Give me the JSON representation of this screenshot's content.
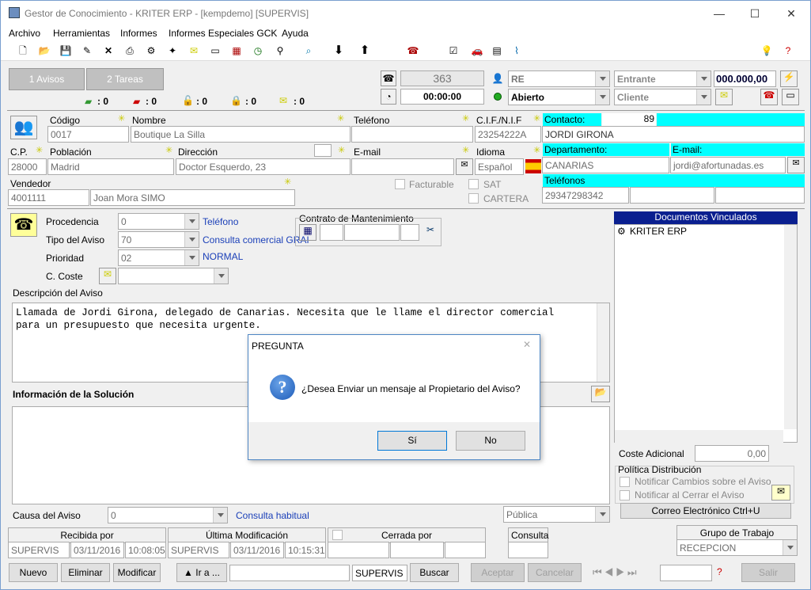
{
  "window": {
    "title": "Gestor de Conocimiento - KRITER ERP - [kempdemo] [SUPERVIS]",
    "minimize": "—",
    "maximize": "☐",
    "close": "✕"
  },
  "menu": [
    "Archivo",
    "Herramientas",
    "Informes",
    "Informes Especiales GCK",
    "Ayuda"
  ],
  "tabs": {
    "avisos": "1 Avisos",
    "tareas": "2 Tareas"
  },
  "counters": [
    ": 0",
    ": 0",
    ": 0",
    ": 0",
    ": 0"
  ],
  "call": {
    "number": "363",
    "timer": "00:00:00",
    "re": "RE",
    "state": "Abierto",
    "direction": "Entrante",
    "type": "Cliente",
    "amount": "000.000,00"
  },
  "customer": {
    "codigo_label": "Código",
    "codigo": "0017",
    "nombre_label": "Nombre",
    "nombre": "Boutique La Silla",
    "telefono_label": "Teléfono",
    "telefono": "",
    "cif_label": "C.I.F./N.I.F",
    "cif": "23254222A",
    "cp_label": "C.P.",
    "cp": "28000",
    "poblacion_label": "Población",
    "poblacion": "Madrid",
    "direccion_label": "Dirección",
    "direccion": "Doctor Esquerdo, 23",
    "email_label": "E-mail",
    "email": "",
    "idioma_label": "Idioma",
    "idioma": "Español",
    "vendedor_label": "Vendedor",
    "vendedor_code": "4001111",
    "vendedor_name": "Joan Mora SIMO",
    "facturable": "Facturable",
    "sat": "SAT",
    "cartera": "CARTERA"
  },
  "contact": {
    "label": "Contacto:",
    "num": "89",
    "name": "JORDI GIRONA",
    "dept_label": "Departamento:",
    "email_label": "E-mail:",
    "dept": "CANARIAS",
    "email": "jordi@afortunadas.es",
    "phones_label": "Teléfonos",
    "phone": "29347298342"
  },
  "aviso": {
    "procedencia_label": "Procedencia",
    "procedencia": "0",
    "procedencia_desc": "Teléfono",
    "tipo_label": "Tipo del Aviso",
    "tipo": "70",
    "tipo_desc": "Consulta comercial GRAI",
    "prioridad_label": "Prioridad",
    "prioridad": "02",
    "prioridad_desc": "NORMAL",
    "coste_label": "C. Coste",
    "contrato_label": "Contrato de Mantenimiento",
    "desc_label": "Descripción del Aviso",
    "desc": "Llamada de Jordi Girona, delegado de Canarias. Necesita que le llame el director comercial\npara un presupuesto que necesita urgente.",
    "solucion_label": "Información de la Solución",
    "causa_label": "Causa del Aviso",
    "causa": "0",
    "causa_desc": "Consulta habitual",
    "visibility": "Pública"
  },
  "docs": {
    "title": "Documentos Vinculados",
    "item": "KRITER ERP",
    "coste_label": "Coste Adicional",
    "coste": "0,00",
    "politica": "Política Distribución",
    "notif1": "Notificar Cambios sobre el Aviso",
    "notif2": "Notificar al Cerrar el Aviso",
    "correo": "Correo Electrónico Ctrl+U"
  },
  "footer": {
    "recibida": "Recibida por",
    "ultima": "Última Modificación",
    "cerrada": "Cerrada por",
    "consulta": "Consulta",
    "grupo": "Grupo de Trabajo",
    "r_user": "SUPERVIS",
    "r_date": "03/11/2016",
    "r_time": "10:08:05",
    "u_user": "SUPERVIS",
    "u_date": "03/11/2016",
    "u_time": "10:15:31",
    "grupo_val": "RECEPCION"
  },
  "buttons": {
    "nuevo": "Nuevo",
    "eliminar": "Eliminar",
    "modificar": "Modificar",
    "ira": "▲ Ir a ...",
    "user": "SUPERVIS",
    "buscar": "Buscar",
    "aceptar": "Aceptar",
    "cancelar": "Cancelar",
    "salir": "Salir"
  },
  "dialog": {
    "title": "PREGUNTA",
    "message": "¿Desea Enviar un mensaje al Propietario del Aviso?",
    "yes": "Sí",
    "no": "No",
    "close": "✕"
  }
}
